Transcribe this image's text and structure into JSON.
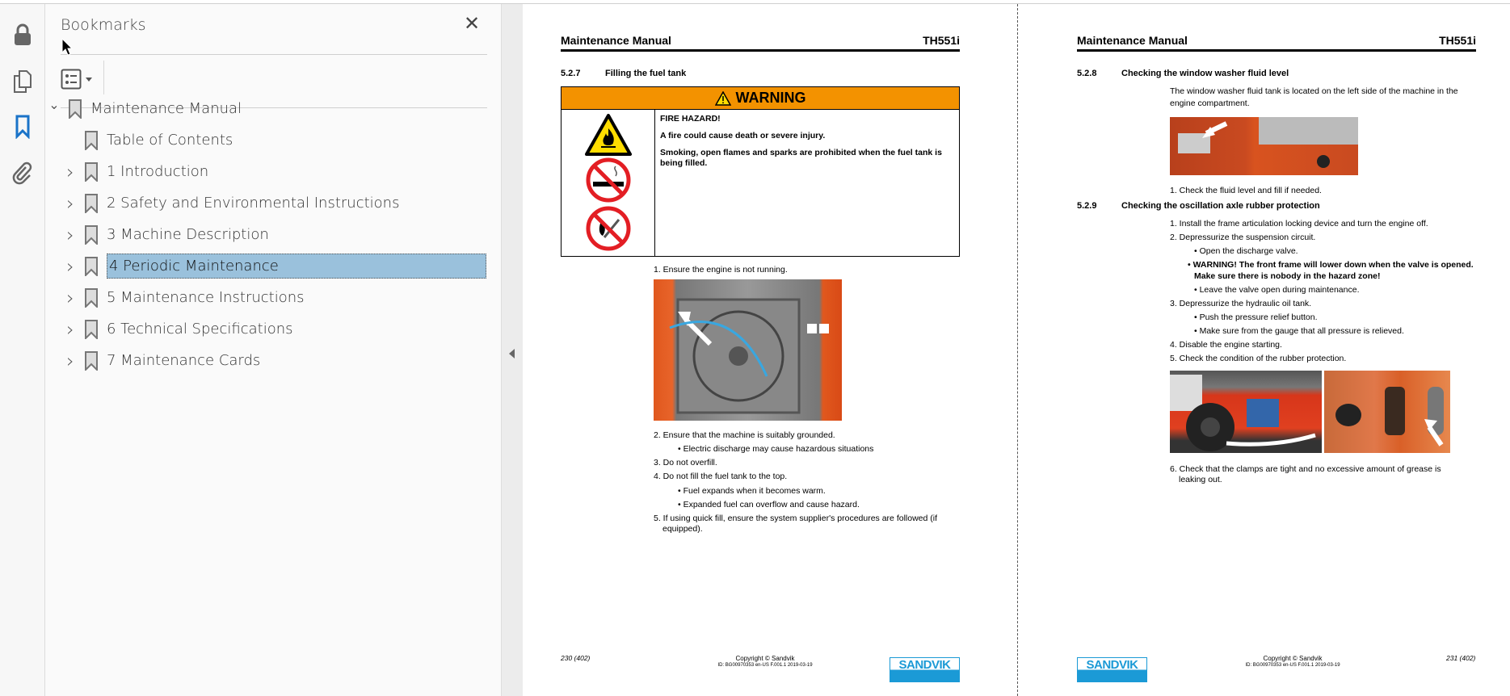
{
  "rail": {
    "icons": [
      "lock-icon",
      "pages-icon",
      "bookmark-icon",
      "attachment-icon"
    ],
    "active": "bookmark-icon",
    "accent": "#1a73c8"
  },
  "bookmarks": {
    "title": "Bookmarks",
    "close": "✕",
    "items": [
      {
        "label": "Maintenance Manual",
        "expanded": true,
        "level": 0
      },
      {
        "label": "Table of Contents",
        "level": 1
      },
      {
        "label": "1 Introduction",
        "level": 1
      },
      {
        "label": "2 Safety and Environmental Instructions",
        "level": 1
      },
      {
        "label": "3 Machine Description",
        "level": 1
      },
      {
        "label": "4 Periodic Maintenance",
        "level": 1,
        "selected": true
      },
      {
        "label": "5 Maintenance Instructions",
        "level": 1
      },
      {
        "label": "6 Technical Specifications",
        "level": 1
      },
      {
        "label": "7 Maintenance Cards",
        "level": 1
      }
    ],
    "selected_color": "#9ac1dc"
  },
  "left_page": {
    "header_title": "Maintenance Manual",
    "header_model": "TH551i",
    "section_num": "5.2.7",
    "section_title": "Filling the fuel tank",
    "warning": {
      "label": "WARNING",
      "l1": "FIRE HAZARD!",
      "l2": "A fire could cause death or severe injury.",
      "l3": "Smoking, open flames and sparks are prohibited when the fuel tank is being filled.",
      "color": "#f39200"
    },
    "step1": "1. Ensure the engine is not running.",
    "step2": "2. Ensure that the machine is suitably grounded.",
    "step2a": "Electric discharge may cause hazardous situations",
    "step3": "3. Do not overfill.",
    "step4": "4. Do not fill the fuel tank to the top.",
    "step4a": "Fuel expands when it becomes warm.",
    "step4b": "Expanded fuel can overflow and cause hazard.",
    "step5": "5. If using quick fill, ensure the system supplier's procedures are followed (if",
    "step5b": "equipped).",
    "page_no": "230 (402)",
    "copyright": "Copyright © Sandvik",
    "doc_id": "ID: BG00970353 en-US F.001.1 2019-03-19",
    "logo": "SANDVIK"
  },
  "right_page": {
    "header_title": "Maintenance Manual",
    "header_model": "TH551i",
    "s1_num": "5.2.8",
    "s1_title": "Checking the window washer fluid level",
    "s1_body": "The window washer fluid tank is located on the left side of the machine in the engine compartment.",
    "s1_step1": "1. Check the fluid level and fill if needed.",
    "s2_num": "5.2.9",
    "s2_title": "Checking the oscillation axle rubber protection",
    "s2_step1": "1. Install the frame articulation locking device and turn the engine off.",
    "s2_step2": "2. Depressurize the suspension circuit.",
    "s2_step2a": "Open the discharge valve.",
    "s2_step2b": "WARNING! The front frame will lower down when the valve is opened. Make sure there is nobody in the hazard zone!",
    "s2_step2c": "Leave the valve open during maintenance.",
    "s2_step3": "3. Depressurize the hydraulic oil tank.",
    "s2_step3a": "Push the pressure relief button.",
    "s2_step3b": "Make sure from the gauge that all pressure is relieved.",
    "s2_step4": "4. Disable the engine starting.",
    "s2_step5": "5. Check the condition of the rubber protection.",
    "s2_step6": "6. Check that the clamps are tight and no excessive amount of grease is",
    "s2_step6b": "leaking out.",
    "page_no": "231 (402)",
    "copyright": "Copyright © Sandvik",
    "doc_id": "ID: BG00970353 en-US F.001.1 2019-03-19",
    "logo": "SANDVIK"
  }
}
